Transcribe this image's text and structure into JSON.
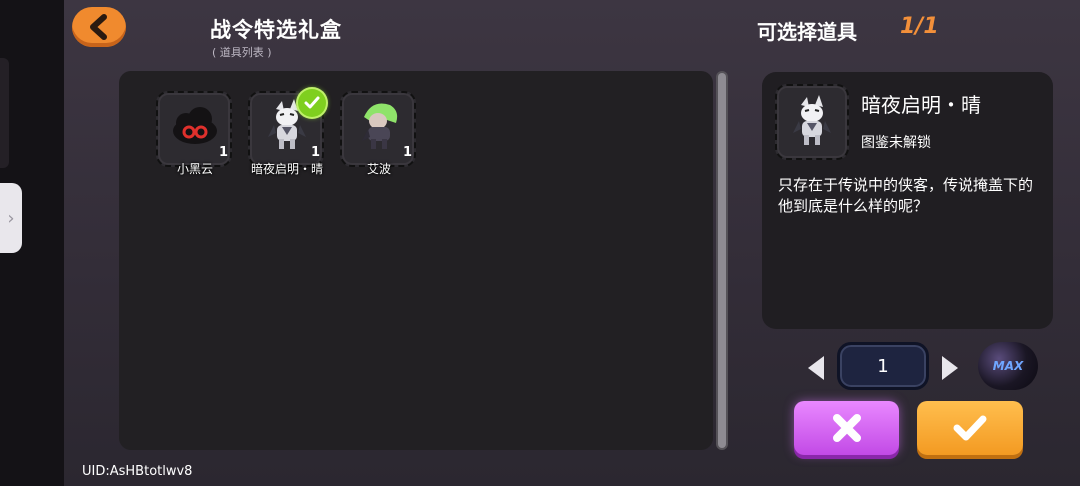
{
  "header": {
    "title": "战令特选礼盒",
    "subtitle": "( 道具列表 )",
    "selectable_label": "可选择道具",
    "selectable_count": "1/1"
  },
  "items": [
    {
      "name": "小黑云",
      "qty": "1",
      "selected": false
    },
    {
      "name": "暗夜启明・晴",
      "qty": "1",
      "selected": true
    },
    {
      "name": "艾波",
      "qty": "1",
      "selected": false
    }
  ],
  "detail": {
    "name": "暗夜启明・晴",
    "status": "图鉴未解锁",
    "description": "只存在于传说中的侠客，传说掩盖下的他到底是什么样的呢？"
  },
  "quantity": {
    "value": "1",
    "max_label": "MAX"
  },
  "uid": "UID:AsHBtotlwv8",
  "colors": {
    "accent_orange": "#f08a2e",
    "confirm": "#f39a22",
    "cancel": "#c24ae6",
    "selected_check": "#7fcf1f",
    "max_text": "#6fa6ff"
  },
  "icons": {
    "back": "chevron-left-icon",
    "selected": "check-icon",
    "cancel": "close-icon",
    "confirm": "check-icon",
    "side_handle": "chevron-right-icon"
  }
}
